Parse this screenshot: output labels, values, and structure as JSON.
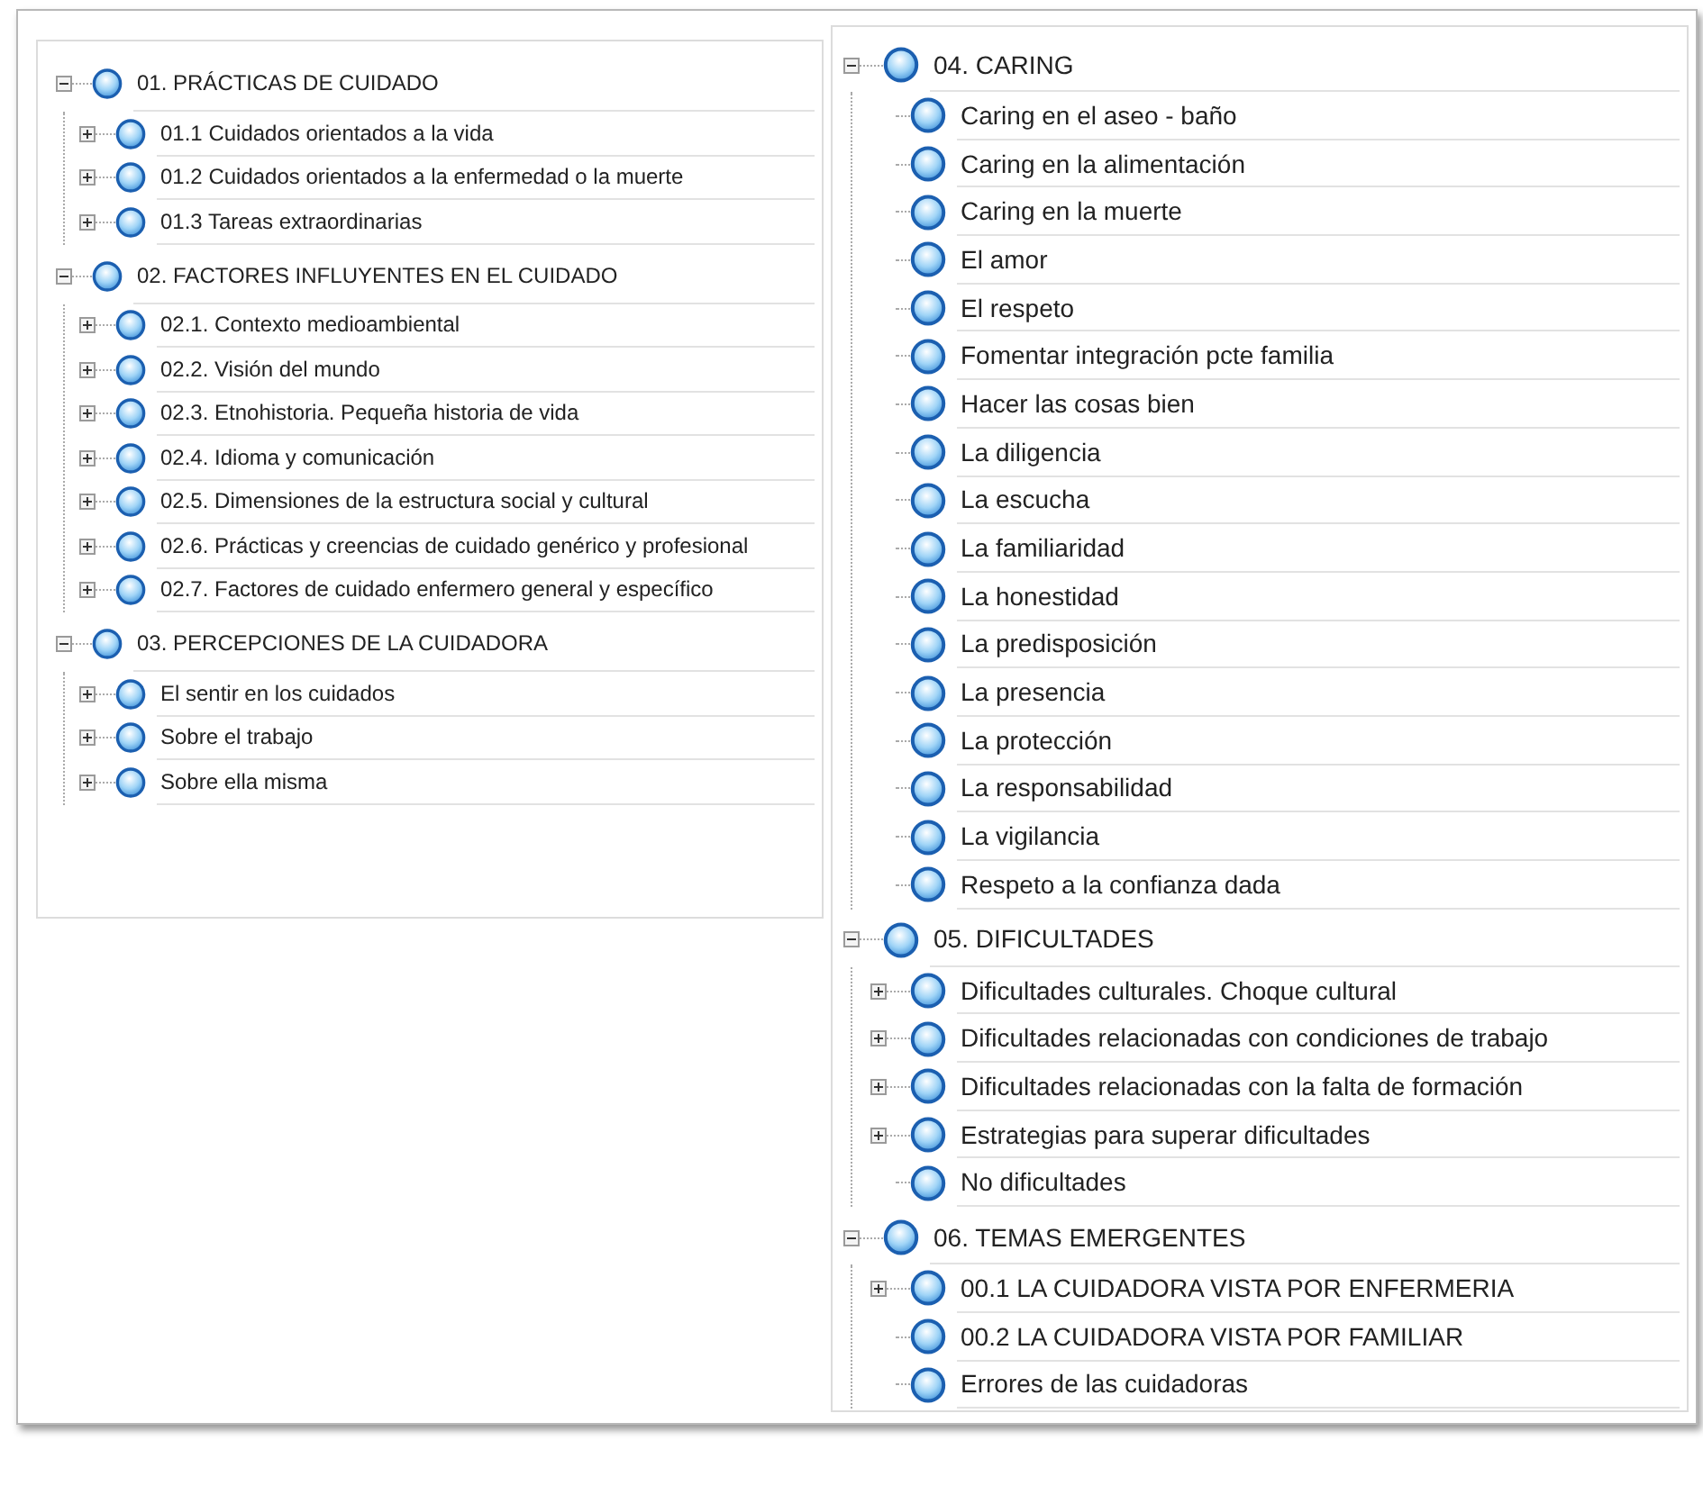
{
  "panels": [
    {
      "nodes": [
        {
          "label": "01. PRÁCTICAS DE CUIDADO",
          "kind": "expanded",
          "children": [
            {
              "label": "01.1 Cuidados orientados a la vida",
              "kind": "collapsed"
            },
            {
              "label": "01.2 Cuidados orientados a la enfermedad o la muerte",
              "kind": "collapsed"
            },
            {
              "label": "01.3 Tareas extraordinarias",
              "kind": "collapsed"
            }
          ]
        },
        {
          "label": "02. FACTORES INFLUYENTES EN EL CUIDADO",
          "kind": "expanded",
          "children": [
            {
              "label": "02.1. Contexto medioambiental",
              "kind": "collapsed"
            },
            {
              "label": "02.2. Visión del mundo",
              "kind": "collapsed"
            },
            {
              "label": "02.3. Etnohistoria. Pequeña historia de vida",
              "kind": "collapsed"
            },
            {
              "label": "02.4. Idioma y comunicación",
              "kind": "collapsed"
            },
            {
              "label": "02.5. Dimensiones de la estructura social y cultural",
              "kind": "collapsed"
            },
            {
              "label": "02.6. Prácticas y creencias de cuidado genérico y profesional",
              "kind": "collapsed"
            },
            {
              "label": "02.7. Factores de cuidado enfermero general y específico",
              "kind": "collapsed"
            }
          ]
        },
        {
          "label": "03. PERCEPCIONES DE LA CUIDADORA",
          "kind": "expanded",
          "children": [
            {
              "label": "El sentir en los cuidados",
              "kind": "collapsed"
            },
            {
              "label": "Sobre el trabajo",
              "kind": "collapsed"
            },
            {
              "label": "Sobre ella misma",
              "kind": "collapsed"
            }
          ]
        }
      ]
    },
    {
      "nodes": [
        {
          "label": "04. CARING",
          "kind": "expanded",
          "children": [
            {
              "label": "Caring en el aseo - baño",
              "kind": "leaf"
            },
            {
              "label": "Caring en la alimentación",
              "kind": "leaf"
            },
            {
              "label": "Caring en la muerte",
              "kind": "leaf"
            },
            {
              "label": "El amor",
              "kind": "leaf"
            },
            {
              "label": "El respeto",
              "kind": "leaf"
            },
            {
              "label": "Fomentar integración pcte familia",
              "kind": "leaf"
            },
            {
              "label": "Hacer las cosas bien",
              "kind": "leaf"
            },
            {
              "label": "La diligencia",
              "kind": "leaf"
            },
            {
              "label": "La escucha",
              "kind": "leaf"
            },
            {
              "label": "La familiaridad",
              "kind": "leaf"
            },
            {
              "label": "La honestidad",
              "kind": "leaf"
            },
            {
              "label": "La predisposición",
              "kind": "leaf"
            },
            {
              "label": "La presencia",
              "kind": "leaf"
            },
            {
              "label": "La protección",
              "kind": "leaf"
            },
            {
              "label": "La responsabilidad",
              "kind": "leaf"
            },
            {
              "label": "La vigilancia",
              "kind": "leaf"
            },
            {
              "label": "Respeto a la confianza dada",
              "kind": "leaf"
            }
          ]
        },
        {
          "label": "05. DIFICULTADES",
          "kind": "expanded",
          "children": [
            {
              "label": "Dificultades culturales. Choque cultural",
              "kind": "collapsed"
            },
            {
              "label": "Dificultades relacionadas con condiciones de trabajo",
              "kind": "collapsed"
            },
            {
              "label": "Dificultades relacionadas con la falta de formación",
              "kind": "collapsed"
            },
            {
              "label": "Estrategias para superar dificultades",
              "kind": "collapsed"
            },
            {
              "label": "No dificultades",
              "kind": "leaf"
            }
          ]
        },
        {
          "label": "06. TEMAS EMERGENTES",
          "kind": "expanded",
          "children": [
            {
              "label": "00.1 LA CUIDADORA VISTA POR ENFERMERIA",
              "kind": "collapsed"
            },
            {
              "label": "00.2 LA CUIDADORA VISTA POR FAMILIAR",
              "kind": "leaf"
            },
            {
              "label": "Errores de las cuidadoras",
              "kind": "leaf"
            }
          ]
        }
      ]
    }
  ]
}
